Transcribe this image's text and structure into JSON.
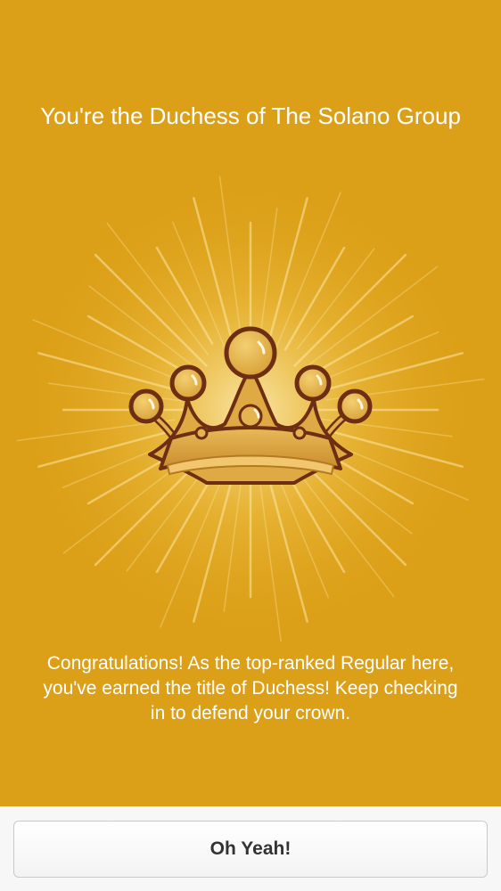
{
  "title": "You're the Duchess of The Solano Group",
  "illustration": {
    "icon": "crown-icon",
    "background": "#dca018"
  },
  "message": "Congratulations! As the top-ranked Regular here, you've earned the title of Duchess! Keep checking in to defend your crown.",
  "cta": {
    "label": "Oh Yeah!"
  }
}
